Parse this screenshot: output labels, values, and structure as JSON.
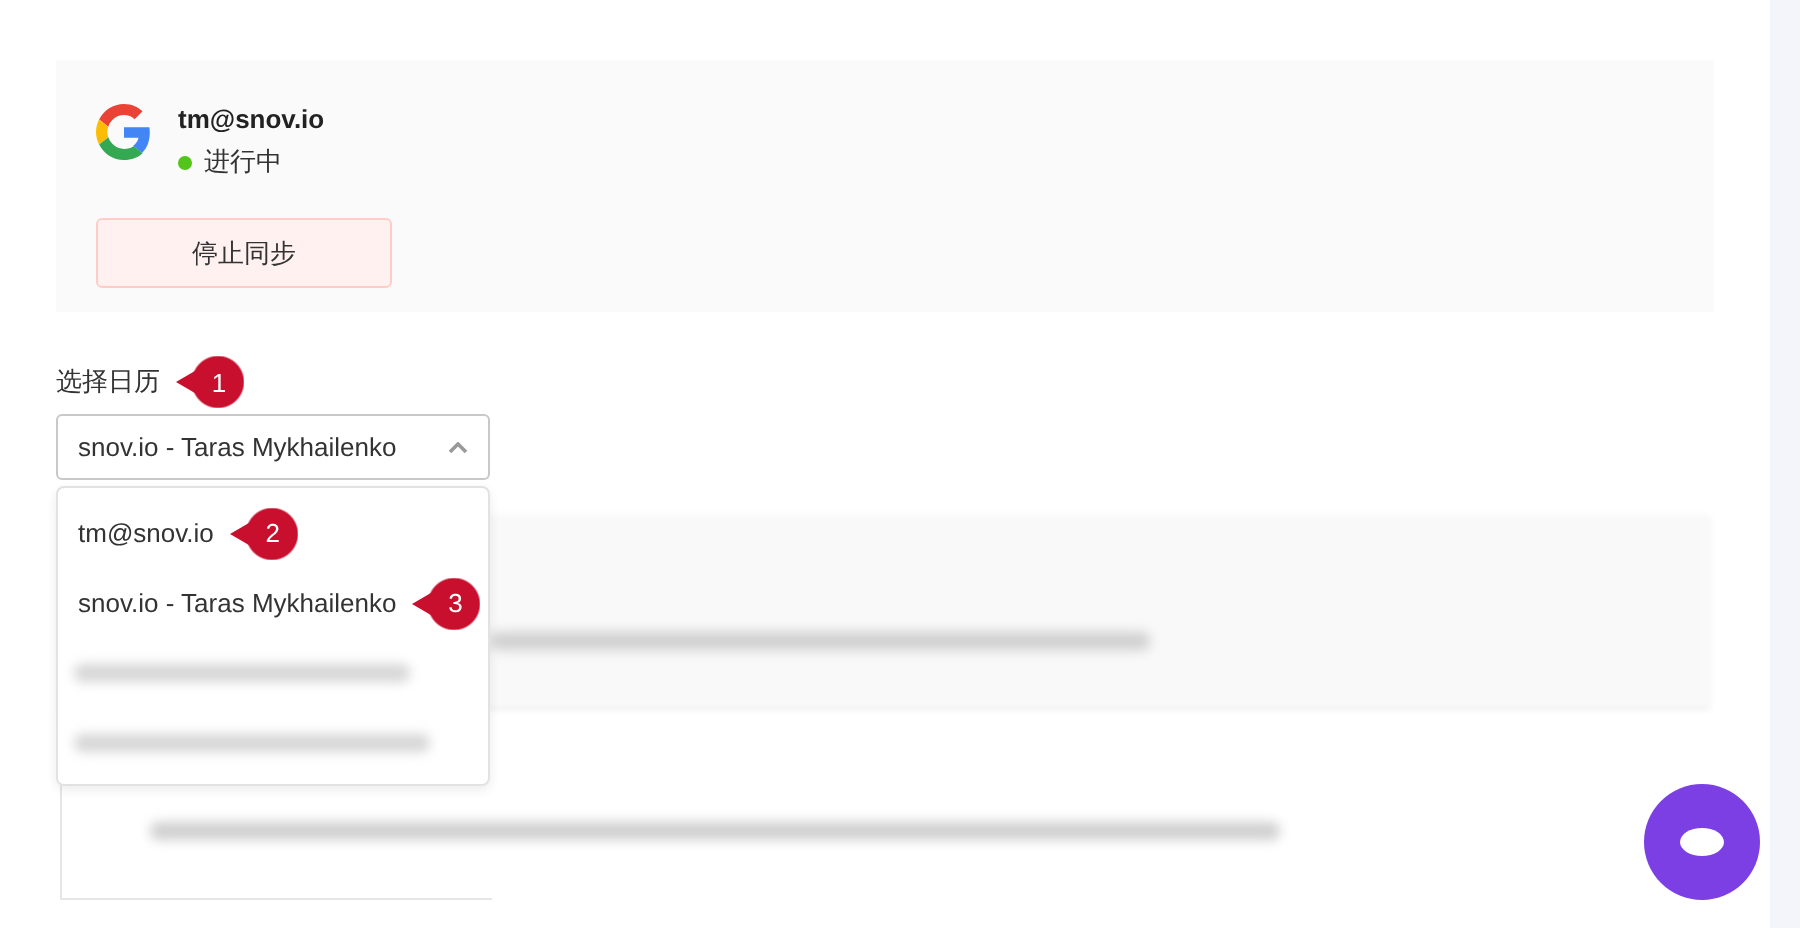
{
  "account": {
    "email": "tm@snov.io",
    "status": "进行中",
    "active": true,
    "stop_button": "停止同步"
  },
  "calendar": {
    "label": "选择日历",
    "label_callout": "1",
    "value": "snov.io - Taras Mykhailenko",
    "expanded": true,
    "options": [
      {
        "kind": "text",
        "label": "tm@snov.io",
        "callout": "2"
      },
      {
        "kind": "text",
        "label": "snov.io - Taras Mykhailenko",
        "callout": "3"
      },
      {
        "kind": "blurred"
      },
      {
        "kind": "blurred"
      }
    ]
  }
}
